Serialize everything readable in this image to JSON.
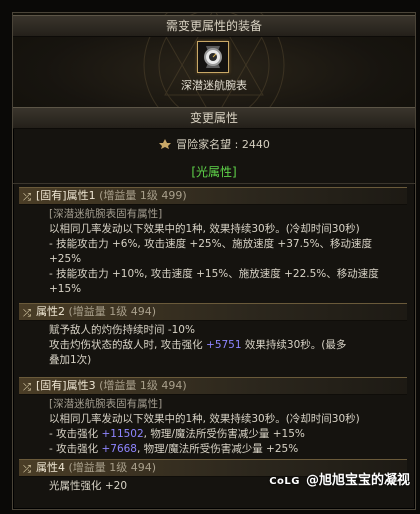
{
  "header": {
    "title": "需变更属性的装备"
  },
  "item": {
    "name": "深潜迷航腕表",
    "icon": "watch-icon"
  },
  "section_title": "变更属性",
  "renown": {
    "label": "冒险家名望",
    "value": "2440",
    "text": "冒险家名望 : 2440"
  },
  "attribute_tab": "[光属性]",
  "sections": [
    {
      "head_main": "[固有]属性1",
      "head_sub": "(增益量 1级 499)",
      "lines": [
        "[深潜迷航腕表固有属性]",
        "以相同几率发动以下效果中的1种, 效果持续30秒。(冷却时间30秒)",
        "- 技能攻击力 +6%, 攻击速度 +25%、施放速度 +37.5%、移动速度",
        "+25%",
        "- 技能攻击力 +10%, 攻击速度 +15%、施放速度 +22.5%、移动速度",
        "+15%"
      ]
    },
    {
      "head_main": "属性2",
      "head_sub": "(增益量 1级 494)",
      "lines": [
        "赋予敌人的灼伤持续时间 -10%",
        "攻击灼伤状态的敌人时, 攻击强化 +5751 效果持续30秒。(最多",
        "叠加1次)"
      ],
      "highlight": "+5751"
    },
    {
      "head_main": "[固有]属性3",
      "head_sub": "(增益量 1级 494)",
      "lines": [
        "[深潜迷航腕表固有属性]",
        "以相同几率发动以下效果中的1种, 效果持续30秒。(冷却时间30秒)",
        "- 攻击强化 +11502, 物理/魔法所受伤害减少量 +15%",
        "- 攻击强化 +7668, 物理/魔法所受伤害减少量 +25%"
      ],
      "highlight_a": "+11502",
      "highlight_b": "+7668"
    },
    {
      "head_main": "属性4",
      "head_sub": "(增益量 1级 494)",
      "lines": [
        "光属性强化 +20"
      ]
    }
  ],
  "watermark": {
    "brand": "CoLG",
    "text": "@旭旭宝宝的凝视"
  },
  "colors": {
    "accent_green": "#5fd34a",
    "highlight_blue": "#8e85ff",
    "gold": "#c9a867"
  }
}
